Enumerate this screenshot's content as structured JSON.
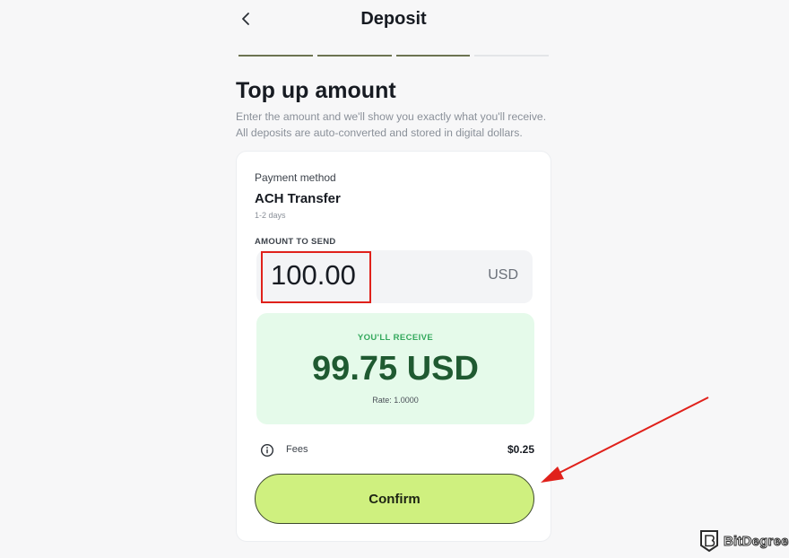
{
  "header": {
    "title": "Deposit",
    "back_icon": "chevron-left-icon"
  },
  "progress": {
    "total_steps": 4,
    "completed_steps": 3,
    "color_done": "#6d7452",
    "color_pending": "#e3e5e8"
  },
  "page": {
    "title": "Top up amount",
    "subtitle": "Enter the amount and we'll show you exactly what you'll receive. All deposits are auto-converted and stored in digital dollars."
  },
  "payment": {
    "label": "Payment method",
    "method": "ACH Transfer",
    "eta": "1-2 days"
  },
  "amount": {
    "label": "AMOUNT TO SEND",
    "value": "100.00",
    "currency": "USD"
  },
  "receive": {
    "label": "YOU'LL RECEIVE",
    "value": "99.75 USD",
    "rate": "Rate: 1.0000"
  },
  "fees": {
    "icon": "info-icon",
    "label": "Fees",
    "value": "$0.25"
  },
  "actions": {
    "confirm_label": "Confirm"
  },
  "annotations": {
    "highlight_color": "#e0211b",
    "arrow_color": "#e0211b"
  },
  "watermark": {
    "text": "BitDegree"
  },
  "colors": {
    "accent": "#cff07f",
    "receive_bg": "#e5faea",
    "receive_text": "#1f5a31",
    "receive_label": "#33a85c"
  }
}
